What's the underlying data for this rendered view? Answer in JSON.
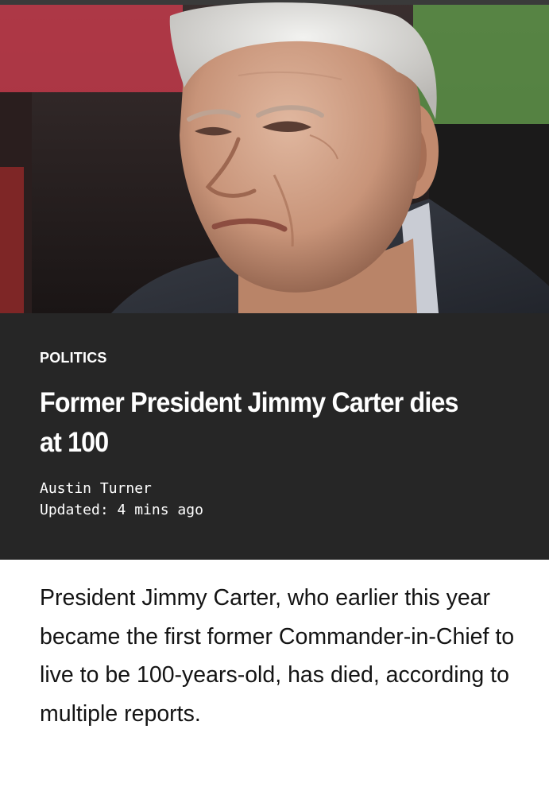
{
  "article": {
    "hero_image_alt": "Jimmy Carter portrait photo",
    "category": "POLITICS",
    "headline": "Former President Jimmy Carter dies at 100",
    "author": "Austin Turner",
    "updated_label": "Updated:",
    "updated_time": "4 mins ago",
    "body": "President Jimmy Carter, who earlier this year became the first former Commander-in-Chief to live to be 100-years-old, has died, according to multiple reports."
  },
  "colors": {
    "header_background": "#262626",
    "header_text": "#ffffff",
    "body_background": "#ffffff",
    "body_text": "#141414"
  }
}
